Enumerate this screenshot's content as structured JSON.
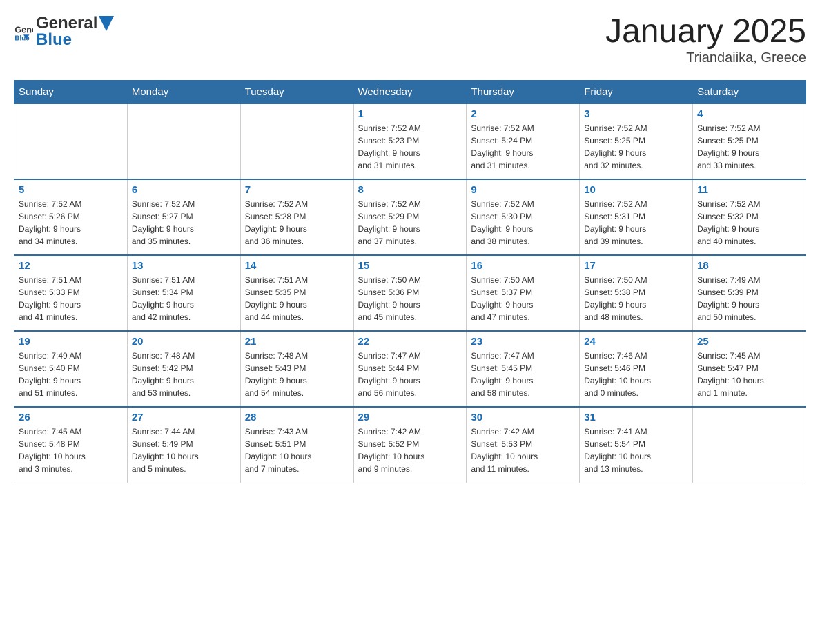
{
  "header": {
    "logo": {
      "general": "General",
      "blue": "Blue"
    },
    "title": "January 2025",
    "subtitle": "Triandaiika, Greece"
  },
  "calendar": {
    "days_of_week": [
      "Sunday",
      "Monday",
      "Tuesday",
      "Wednesday",
      "Thursday",
      "Friday",
      "Saturday"
    ],
    "weeks": [
      [
        {
          "day": "",
          "info": ""
        },
        {
          "day": "",
          "info": ""
        },
        {
          "day": "",
          "info": ""
        },
        {
          "day": "1",
          "info": "Sunrise: 7:52 AM\nSunset: 5:23 PM\nDaylight: 9 hours\nand 31 minutes."
        },
        {
          "day": "2",
          "info": "Sunrise: 7:52 AM\nSunset: 5:24 PM\nDaylight: 9 hours\nand 31 minutes."
        },
        {
          "day": "3",
          "info": "Sunrise: 7:52 AM\nSunset: 5:25 PM\nDaylight: 9 hours\nand 32 minutes."
        },
        {
          "day": "4",
          "info": "Sunrise: 7:52 AM\nSunset: 5:25 PM\nDaylight: 9 hours\nand 33 minutes."
        }
      ],
      [
        {
          "day": "5",
          "info": "Sunrise: 7:52 AM\nSunset: 5:26 PM\nDaylight: 9 hours\nand 34 minutes."
        },
        {
          "day": "6",
          "info": "Sunrise: 7:52 AM\nSunset: 5:27 PM\nDaylight: 9 hours\nand 35 minutes."
        },
        {
          "day": "7",
          "info": "Sunrise: 7:52 AM\nSunset: 5:28 PM\nDaylight: 9 hours\nand 36 minutes."
        },
        {
          "day": "8",
          "info": "Sunrise: 7:52 AM\nSunset: 5:29 PM\nDaylight: 9 hours\nand 37 minutes."
        },
        {
          "day": "9",
          "info": "Sunrise: 7:52 AM\nSunset: 5:30 PM\nDaylight: 9 hours\nand 38 minutes."
        },
        {
          "day": "10",
          "info": "Sunrise: 7:52 AM\nSunset: 5:31 PM\nDaylight: 9 hours\nand 39 minutes."
        },
        {
          "day": "11",
          "info": "Sunrise: 7:52 AM\nSunset: 5:32 PM\nDaylight: 9 hours\nand 40 minutes."
        }
      ],
      [
        {
          "day": "12",
          "info": "Sunrise: 7:51 AM\nSunset: 5:33 PM\nDaylight: 9 hours\nand 41 minutes."
        },
        {
          "day": "13",
          "info": "Sunrise: 7:51 AM\nSunset: 5:34 PM\nDaylight: 9 hours\nand 42 minutes."
        },
        {
          "day": "14",
          "info": "Sunrise: 7:51 AM\nSunset: 5:35 PM\nDaylight: 9 hours\nand 44 minutes."
        },
        {
          "day": "15",
          "info": "Sunrise: 7:50 AM\nSunset: 5:36 PM\nDaylight: 9 hours\nand 45 minutes."
        },
        {
          "day": "16",
          "info": "Sunrise: 7:50 AM\nSunset: 5:37 PM\nDaylight: 9 hours\nand 47 minutes."
        },
        {
          "day": "17",
          "info": "Sunrise: 7:50 AM\nSunset: 5:38 PM\nDaylight: 9 hours\nand 48 minutes."
        },
        {
          "day": "18",
          "info": "Sunrise: 7:49 AM\nSunset: 5:39 PM\nDaylight: 9 hours\nand 50 minutes."
        }
      ],
      [
        {
          "day": "19",
          "info": "Sunrise: 7:49 AM\nSunset: 5:40 PM\nDaylight: 9 hours\nand 51 minutes."
        },
        {
          "day": "20",
          "info": "Sunrise: 7:48 AM\nSunset: 5:42 PM\nDaylight: 9 hours\nand 53 minutes."
        },
        {
          "day": "21",
          "info": "Sunrise: 7:48 AM\nSunset: 5:43 PM\nDaylight: 9 hours\nand 54 minutes."
        },
        {
          "day": "22",
          "info": "Sunrise: 7:47 AM\nSunset: 5:44 PM\nDaylight: 9 hours\nand 56 minutes."
        },
        {
          "day": "23",
          "info": "Sunrise: 7:47 AM\nSunset: 5:45 PM\nDaylight: 9 hours\nand 58 minutes."
        },
        {
          "day": "24",
          "info": "Sunrise: 7:46 AM\nSunset: 5:46 PM\nDaylight: 10 hours\nand 0 minutes."
        },
        {
          "day": "25",
          "info": "Sunrise: 7:45 AM\nSunset: 5:47 PM\nDaylight: 10 hours\nand 1 minute."
        }
      ],
      [
        {
          "day": "26",
          "info": "Sunrise: 7:45 AM\nSunset: 5:48 PM\nDaylight: 10 hours\nand 3 minutes."
        },
        {
          "day": "27",
          "info": "Sunrise: 7:44 AM\nSunset: 5:49 PM\nDaylight: 10 hours\nand 5 minutes."
        },
        {
          "day": "28",
          "info": "Sunrise: 7:43 AM\nSunset: 5:51 PM\nDaylight: 10 hours\nand 7 minutes."
        },
        {
          "day": "29",
          "info": "Sunrise: 7:42 AM\nSunset: 5:52 PM\nDaylight: 10 hours\nand 9 minutes."
        },
        {
          "day": "30",
          "info": "Sunrise: 7:42 AM\nSunset: 5:53 PM\nDaylight: 10 hours\nand 11 minutes."
        },
        {
          "day": "31",
          "info": "Sunrise: 7:41 AM\nSunset: 5:54 PM\nDaylight: 10 hours\nand 13 minutes."
        },
        {
          "day": "",
          "info": ""
        }
      ]
    ]
  }
}
